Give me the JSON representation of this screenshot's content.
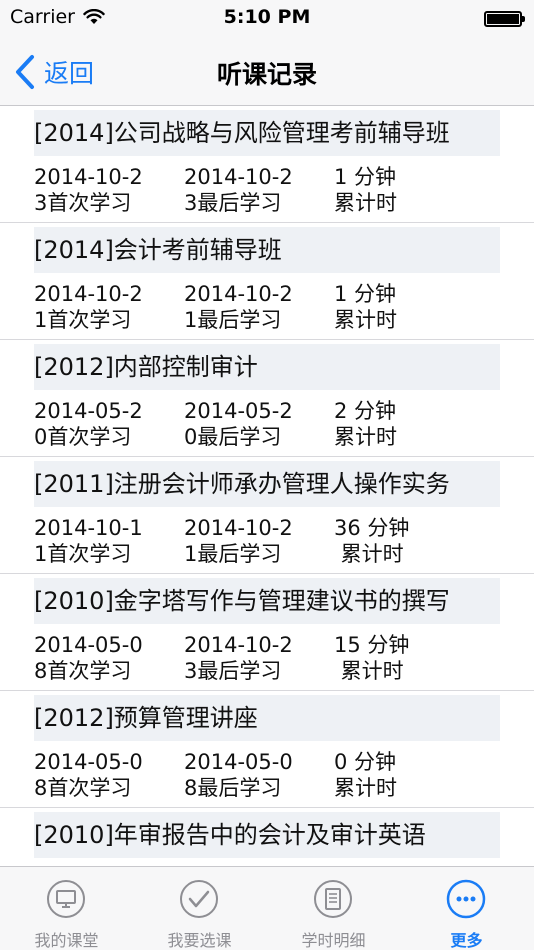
{
  "status": {
    "carrier": "Carrier",
    "time": "5:10 PM"
  },
  "nav": {
    "back_label": "返回",
    "title": "听课记录"
  },
  "courses": [
    {
      "title": "[2014]公司战略与风险管理考前辅导班",
      "first_date": "2014-10-2",
      "first_label": "3首次学习",
      "last_date": "2014-10-2",
      "last_label": "3最后学习",
      "duration": "1 分钟",
      "total_label": "累计时"
    },
    {
      "title": "[2014]会计考前辅导班",
      "first_date": "2014-10-2",
      "first_label": "1首次学习",
      "last_date": "2014-10-2",
      "last_label": "1最后学习",
      "duration": "1 分钟",
      "total_label": "累计时"
    },
    {
      "title": "[2012]内部控制审计",
      "first_date": "2014-05-2",
      "first_label": "0首次学习",
      "last_date": "2014-05-2",
      "last_label": "0最后学习",
      "duration": "2 分钟",
      "total_label": "累计时"
    },
    {
      "title": "[2011]注册会计师承办管理人操作实务",
      "first_date": "2014-10-1",
      "first_label": "1首次学习",
      "last_date": "2014-10-2",
      "last_label": "1最后学习",
      "duration": "36 分钟",
      "total_label": " 累计时"
    },
    {
      "title": "[2010]金字塔写作与管理建议书的撰写",
      "first_date": "2014-05-0",
      "first_label": "8首次学习",
      "last_date": "2014-10-2",
      "last_label": "3最后学习",
      "duration": "15 分钟",
      "total_label": " 累计时"
    },
    {
      "title": "[2012]预算管理讲座",
      "first_date": "2014-05-0",
      "first_label": "8首次学习",
      "last_date": "2014-05-0",
      "last_label": "8最后学习",
      "duration": "0 分钟",
      "total_label": "累计时"
    },
    {
      "title": "[2010]年审报告中的会计及审计英语",
      "first_date": "",
      "first_label": "",
      "last_date": "",
      "last_label": "",
      "duration": "",
      "total_label": ""
    }
  ],
  "tabs": [
    {
      "label": "我的课堂",
      "icon": "monitor-icon"
    },
    {
      "label": "我要选课",
      "icon": "checkmark-icon"
    },
    {
      "label": "学时明细",
      "icon": "document-icon"
    },
    {
      "label": "更多",
      "icon": "more-icon"
    }
  ],
  "colors": {
    "accent": "#1a7cf5",
    "title_bg": "#eef1f5",
    "bar_bg": "#f7f7f8"
  }
}
